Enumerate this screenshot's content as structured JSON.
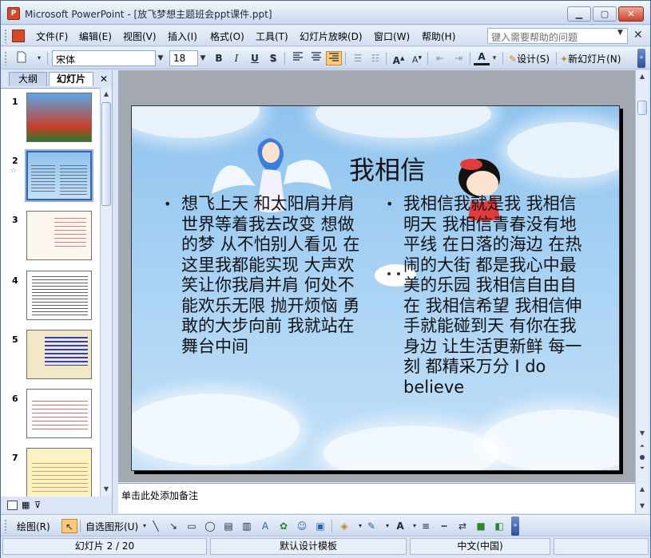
{
  "window": {
    "title": "Microsoft PowerPoint - [放飞梦想主题班会ppt课件.ppt]",
    "app_icon_label": "P",
    "minimize": "▁",
    "maximize": "▢",
    "close": "✕"
  },
  "menu": {
    "items": [
      "文件(F)",
      "编辑(E)",
      "视图(V)",
      "插入(I)",
      "格式(O)",
      "工具(T)",
      "幻灯片放映(D)",
      "窗口(W)",
      "帮助(H)"
    ],
    "help_placeholder": "键入需要帮助的问题",
    "close_glyph": "✕"
  },
  "format_toolbar": {
    "font_name": "宋体",
    "font_size": "18",
    "bold": "B",
    "italic": "I",
    "underline": "U",
    "shadow": "S",
    "font_color_glyph": "A",
    "design_label": "设计(S)",
    "new_slide_label": "新幻灯片(N)"
  },
  "left_pane": {
    "tab_outline": "大纲",
    "tab_slides": "幻灯片",
    "close_glyph": "✕",
    "slide_numbers": [
      "1",
      "2",
      "3",
      "4",
      "5",
      "6",
      "7"
    ],
    "selected_slide": 2
  },
  "slide": {
    "title": "我相信",
    "left_column": "想飞上天 和太阳肩并肩 世界等着我去改变 想做的梦 从不怕别人看见 在这里我都能实现 大声欢笑让你我肩并肩 何处不能欢乐无限 抛开烦恼 勇敢的大步向前 我就站在舞台中间",
    "right_column": "我相信我就是我 我相信明天 我相信青春没有地平线 在日落的海边 在热闹的大街 都是我心中最美的乐园 我相信自由自在 我相信希望 我相信伸手就能碰到天 有你在我身边 让生活更新鲜 每一刻 都精采万分 I do believe",
    "bullet": "•"
  },
  "notes": {
    "placeholder": "单击此处添加备注"
  },
  "drawing_toolbar": {
    "draw_label": "绘图(R)",
    "autoshapes_label": "自选图形(U)"
  },
  "status": {
    "slide_position": "幻灯片 2 / 20",
    "design_template": "默认设计模板",
    "language": "中文(中国)"
  },
  "colors": {
    "accent": "#3b62a7",
    "title_bar_gradient_top": "#f3f7fd",
    "slide_sky": "#a8d2f4",
    "close_red": "#c6452b"
  }
}
